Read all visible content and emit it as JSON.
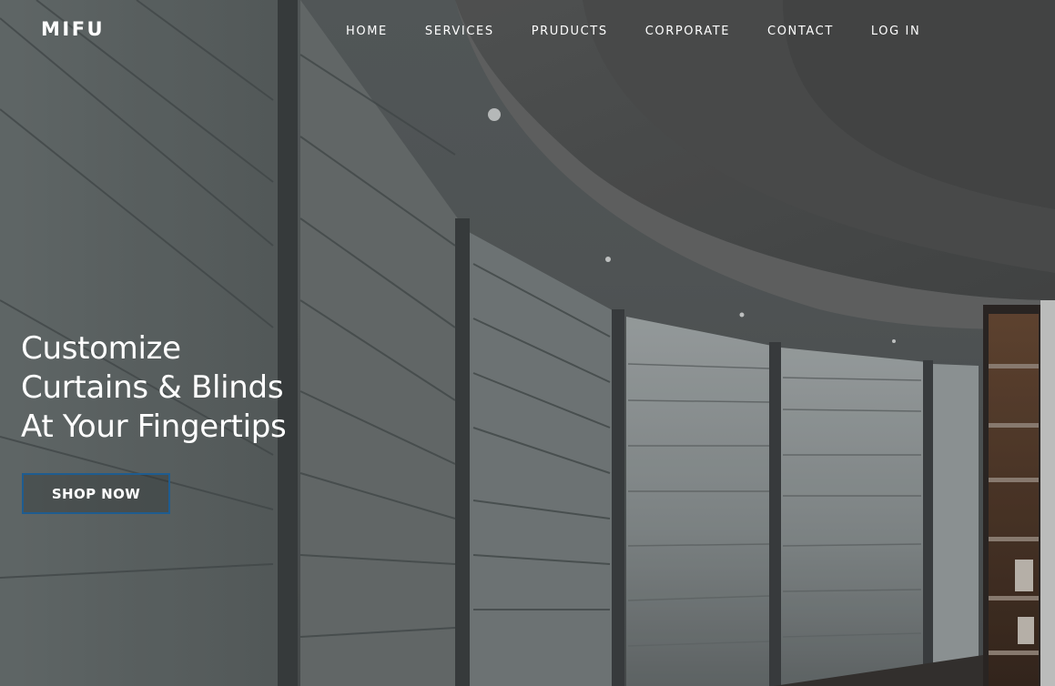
{
  "brand": {
    "logo_text": "MIFU"
  },
  "nav": {
    "items": [
      {
        "label": "HOME"
      },
      {
        "label": "SERVICES"
      },
      {
        "label": "PRUDUCTS"
      },
      {
        "label": "CORPORATE"
      },
      {
        "label": "CONTACT"
      },
      {
        "label": "LOG IN"
      }
    ]
  },
  "hero": {
    "headline_lines": [
      "Customize",
      "Curtains & Blinds",
      "At Your Fingertips"
    ],
    "cta_label": "SHOP NOW",
    "background_image": "interior-roman-blinds-photo"
  },
  "colors": {
    "text": "#ffffff",
    "cta_border": "#1f5c8f",
    "photo_base": "#5a5f60"
  }
}
